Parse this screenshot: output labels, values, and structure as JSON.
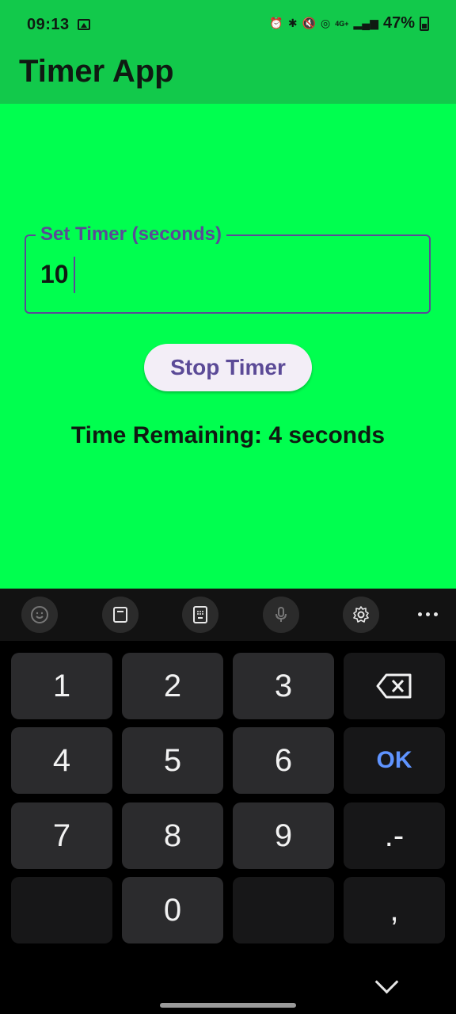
{
  "status_bar": {
    "time": "09:13",
    "icons": [
      "gallery-icon",
      "alarm-icon",
      "bluetooth-icon",
      "mute-icon",
      "hotspot-icon",
      "4g-icon",
      "signal-icon",
      "battery-icon"
    ],
    "network": "4G+",
    "battery": "47%"
  },
  "app_bar": {
    "title": "Timer App"
  },
  "timer_form": {
    "field_label": "Set Timer (seconds)",
    "field_value": "10",
    "stop_button_label": "Stop Timer",
    "time_remaining": "Time Remaining: 4 seconds"
  },
  "keyboard_toolbar": {
    "buttons": [
      "emoji-icon",
      "clipboard-icon",
      "keypad-icon",
      "mic-icon",
      "settings-icon",
      "more-icon"
    ]
  },
  "keypad": {
    "keys": [
      "1",
      "2",
      "3",
      "backspace",
      "4",
      "5",
      "6",
      "OK",
      "7",
      "8",
      "9",
      ".-",
      "",
      "0",
      "",
      ","
    ],
    "ok_label": "OK"
  },
  "colors": {
    "app_bar_bg": "#12c94b",
    "content_bg": "#00ff4f",
    "accent_purple": "#5b4a97",
    "button_bg": "#f3eef7",
    "keyboard_bg": "#000000",
    "key_bg": "#2b2b2d",
    "ok_blue": "#5f94ff"
  }
}
